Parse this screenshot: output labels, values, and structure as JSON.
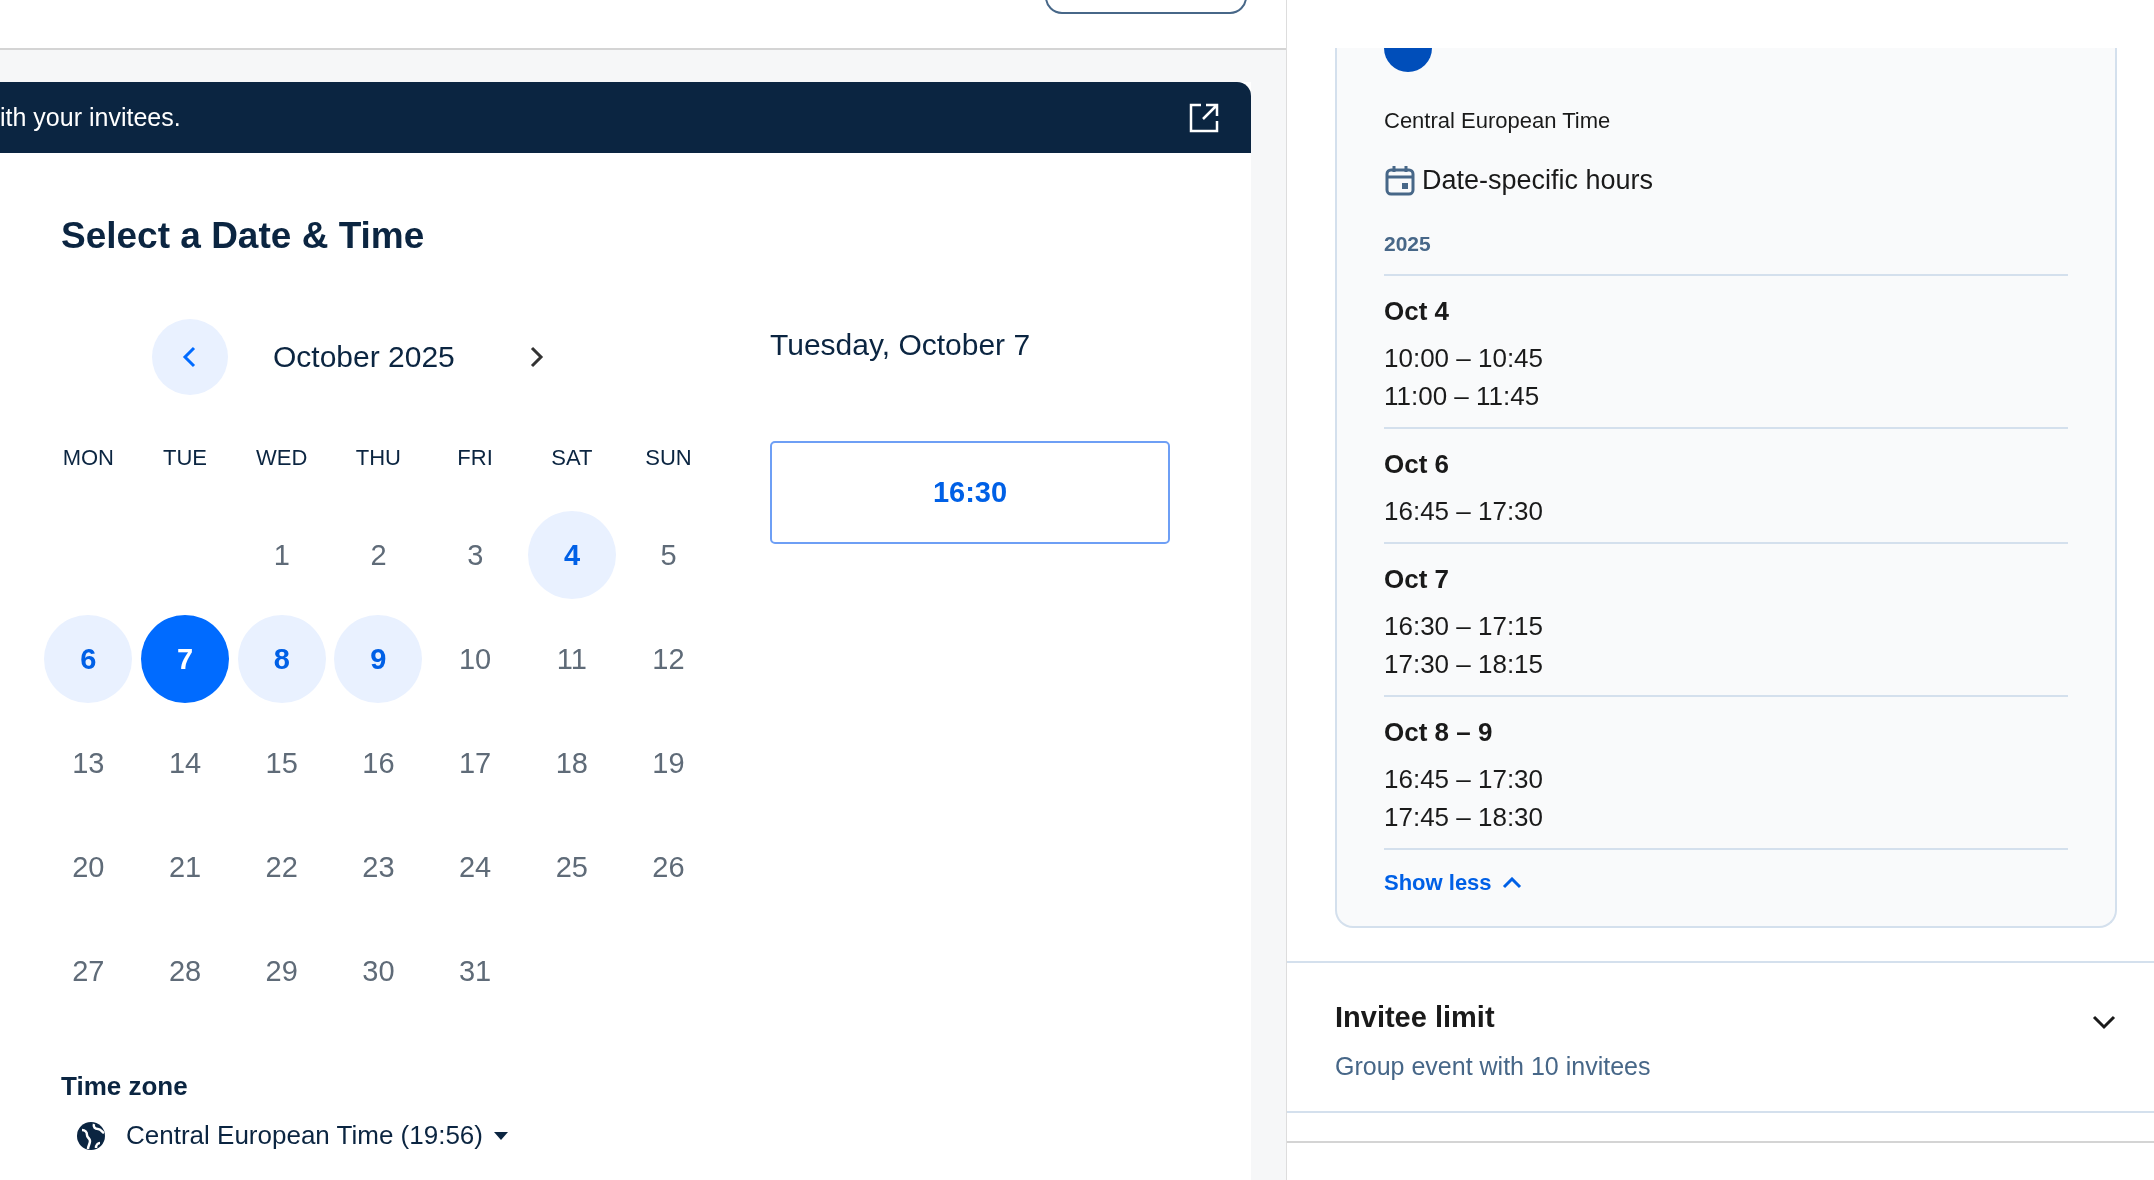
{
  "banner": {
    "text": "ith your invitees."
  },
  "scheduler": {
    "title": "Select a Date & Time",
    "month": "October 2025",
    "weekdays": [
      "MON",
      "TUE",
      "WED",
      "THU",
      "FRI",
      "SAT",
      "SUN"
    ],
    "weeks": [
      {
        "days": [
          {
            "label": "1",
            "available": false,
            "selected": false
          },
          {
            "label": "2",
            "available": false,
            "selected": false
          },
          {
            "label": "3",
            "available": false,
            "selected": false
          },
          {
            "label": "4",
            "available": true,
            "selected": false
          },
          {
            "label": "5",
            "available": false,
            "selected": false
          }
        ]
      },
      {
        "days": [
          {
            "label": "6",
            "available": true,
            "selected": false
          },
          {
            "label": "7",
            "available": true,
            "selected": true
          },
          {
            "label": "8",
            "available": true,
            "selected": false
          },
          {
            "label": "9",
            "available": true,
            "selected": false
          },
          {
            "label": "10",
            "available": false,
            "selected": false
          },
          {
            "label": "11",
            "available": false,
            "selected": false
          },
          {
            "label": "12",
            "available": false,
            "selected": false
          }
        ]
      },
      {
        "days": [
          {
            "label": "13",
            "available": false,
            "selected": false
          },
          {
            "label": "14",
            "available": false,
            "selected": false
          },
          {
            "label": "15",
            "available": false,
            "selected": false
          },
          {
            "label": "16",
            "available": false,
            "selected": false
          },
          {
            "label": "17",
            "available": false,
            "selected": false
          },
          {
            "label": "18",
            "available": false,
            "selected": false
          },
          {
            "label": "19",
            "available": false,
            "selected": false
          }
        ]
      },
      {
        "days": [
          {
            "label": "20",
            "available": false,
            "selected": false
          },
          {
            "label": "21",
            "available": false,
            "selected": false
          },
          {
            "label": "22",
            "available": false,
            "selected": false
          },
          {
            "label": "23",
            "available": false,
            "selected": false
          },
          {
            "label": "24",
            "available": false,
            "selected": false
          },
          {
            "label": "25",
            "available": false,
            "selected": false
          },
          {
            "label": "26",
            "available": false,
            "selected": false
          }
        ]
      },
      {
        "days": [
          {
            "label": "27",
            "available": false,
            "selected": false
          },
          {
            "label": "28",
            "available": false,
            "selected": false
          },
          {
            "label": "29",
            "available": false,
            "selected": false
          },
          {
            "label": "30",
            "available": false,
            "selected": false
          },
          {
            "label": "31",
            "available": false,
            "selected": false
          }
        ]
      }
    ],
    "date_heading": "Tuesday, October 7",
    "time_slots": [
      {
        "label": "16:30",
        "selected": false
      }
    ],
    "timezone": {
      "label": "Time zone",
      "value": "Central European Time (19:56)"
    }
  },
  "availability": {
    "timezone": "Central European Time",
    "section_title": "Date-specific hours",
    "year": "2025",
    "groups": [
      {
        "date": "Oct 4",
        "times": [
          "10:00 – 10:45",
          "11:00 – 11:45"
        ]
      },
      {
        "date": "Oct 6",
        "times": [
          "16:45 – 17:30"
        ]
      },
      {
        "date": "Oct 7",
        "times": [
          "16:30 – 17:15",
          "17:30 – 18:15"
        ]
      },
      {
        "date": "Oct 8 – 9",
        "times": [
          "16:45 – 17:30",
          "17:45 – 18:30"
        ]
      }
    ],
    "toggle_link": "Show less"
  },
  "invitee_limit": {
    "title": "Invitee limit",
    "subtitle": "Group event with 10 invitees",
    "expanded": false
  }
}
